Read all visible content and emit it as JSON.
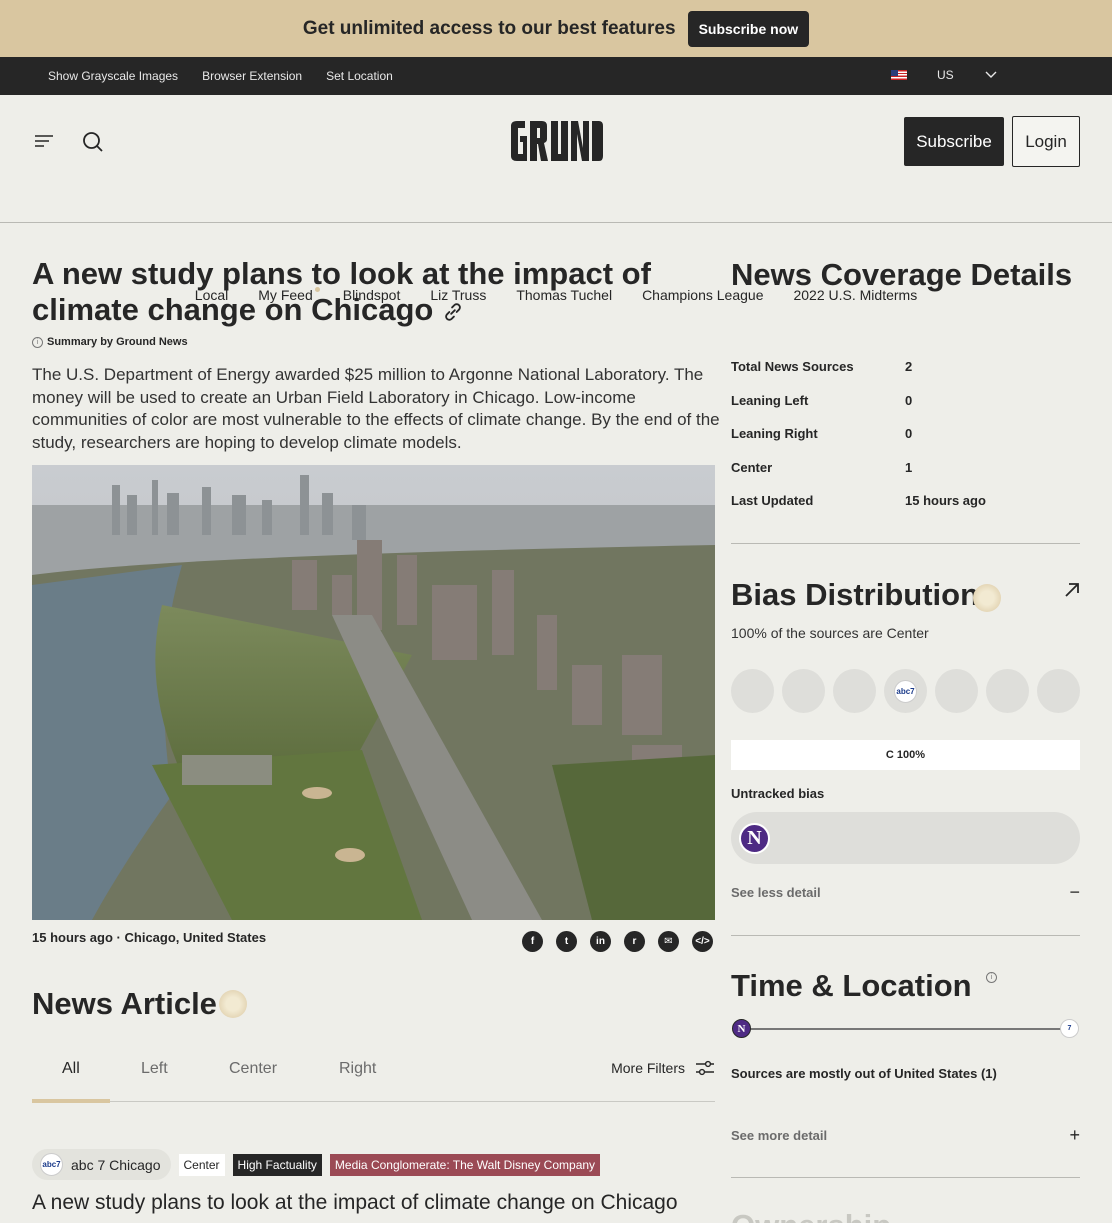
{
  "promo": {
    "text": "Get unlimited access to our best features",
    "button": "Subscribe now"
  },
  "util": {
    "links": [
      "Show Grayscale Images",
      "Browser Extension",
      "Set Location"
    ],
    "region": "US"
  },
  "header": {
    "logo_alt": "GROUND",
    "subscribe": "Subscribe",
    "login": "Login"
  },
  "nav": [
    "Local",
    "My Feed",
    "Blindspot",
    "Liz Truss",
    "Thomas Tuchel",
    "Champions League",
    "2022 U.S. Midterms"
  ],
  "article": {
    "title": "A new study plans to look at the impact of climate change on Chicago",
    "summary_by": "Summary by Ground News",
    "summary": "The U.S. Department of Energy awarded $25 million to Argonne National Laboratory. The money will be used to create an Urban Field Laboratory in Chicago. Low-income communities of color are most vulnerable to the effects of climate change. By the end of the study, researchers are hoping to develop climate models.",
    "time": "15 hours ago",
    "location": "Chicago, United States"
  },
  "news_articles": {
    "title": "News Article",
    "tabs": [
      "All",
      "Left",
      "Center",
      "Right"
    ],
    "more_filters": "More Filters",
    "first": {
      "source": "abc 7 Chicago",
      "tags": [
        "Center",
        "High Factuality",
        "Media Conglomerate: The Walt Disney Company"
      ],
      "title": "A new study plans to look at the impact of climate change on Chicago"
    }
  },
  "coverage": {
    "title": "News Coverage Details",
    "rows": [
      {
        "k": "Total News Sources",
        "v": "2"
      },
      {
        "k": "Leaning Left",
        "v": "0"
      },
      {
        "k": "Leaning Right",
        "v": "0"
      },
      {
        "k": "Center",
        "v": "1"
      },
      {
        "k": "Last Updated",
        "v": "15 hours ago"
      }
    ]
  },
  "bias": {
    "title": "Bias Distribution",
    "subtitle": "100% of the sources are Center",
    "bar_label": "C 100%",
    "center_percent": 100,
    "untracked": "Untracked bias",
    "see_less": "See less detail"
  },
  "time_location": {
    "title": "Time & Location",
    "summary": "Sources are mostly out of United States (1)",
    "see_more": "See more detail"
  },
  "ownership": {
    "title": "Ownership"
  }
}
